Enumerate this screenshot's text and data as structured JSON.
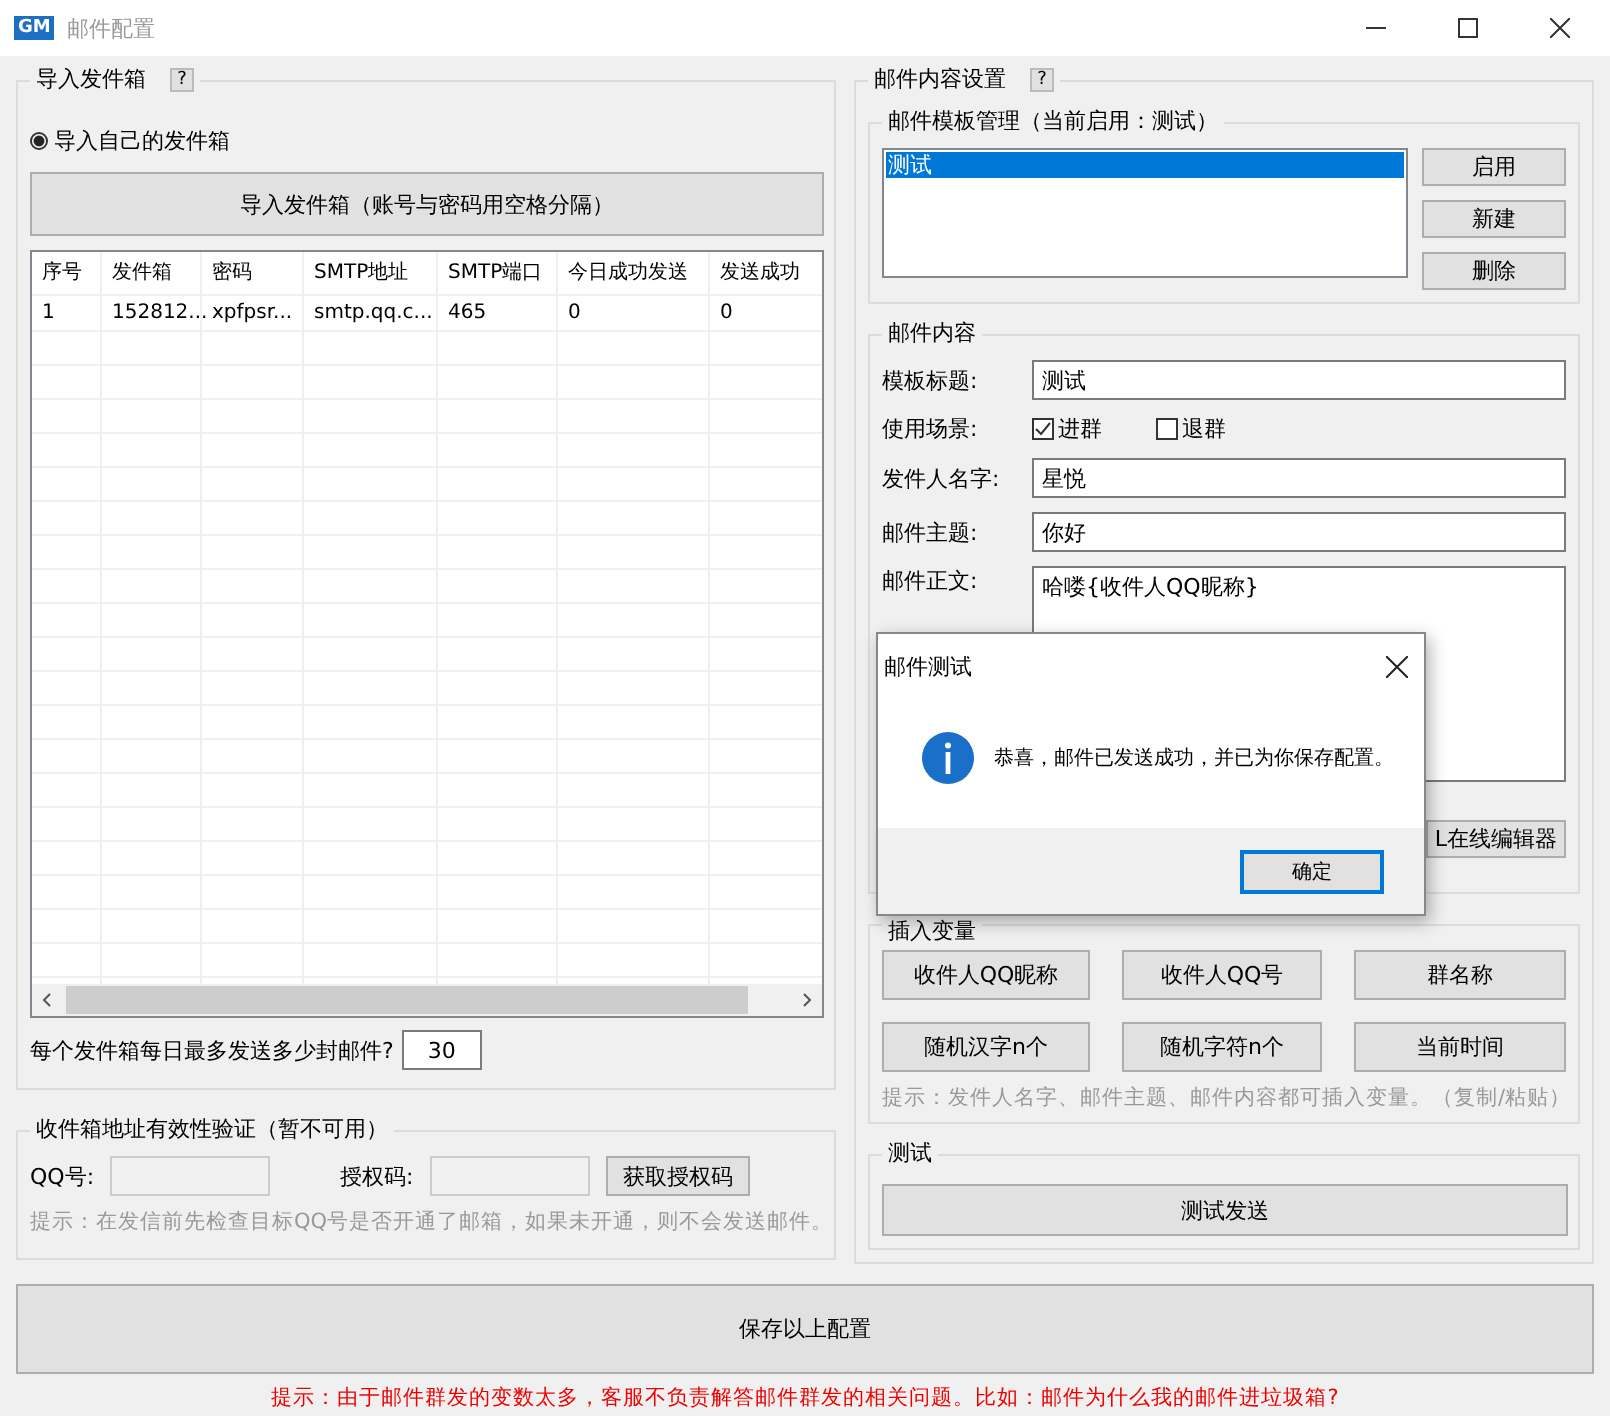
{
  "window": {
    "logo": "GM",
    "title": "邮件配置"
  },
  "import_group": {
    "title": "导入发件箱",
    "help": "?",
    "radio": {
      "label": "导入自己的发件箱",
      "selected": true
    },
    "import_button": "导入发件箱（账号与密码用空格分隔）",
    "table": {
      "columns": [
        "序号",
        "发件箱",
        "密码",
        "SMTP地址",
        "SMTP端口",
        "今日成功发送",
        "发送成功"
      ],
      "rows": [
        [
          "1",
          "152812...",
          "xpfpsr...",
          "smtp.qq.c...",
          "465",
          "0",
          "0"
        ]
      ]
    },
    "daily_limit": {
      "label": "每个发件箱每日最多发送多少封邮件?",
      "value": "30"
    }
  },
  "verify_group": {
    "title": "收件箱地址有效性验证（暂不可用）",
    "qq_label": "QQ号:",
    "auth_label": "授权码:",
    "get_button": "获取授权码",
    "hint": "提示：在发信前先检查目标QQ号是否开通了邮箱，如果未开通，则不会发送邮件。"
  },
  "content_group": {
    "title": "邮件内容设置",
    "help": "?",
    "template_group": {
      "title": "邮件模板管理（当前启用：测试）",
      "items": [
        {
          "label": "测试",
          "selected": true
        }
      ],
      "buttons": [
        "启用",
        "新建",
        "删除"
      ]
    },
    "mail_group": {
      "title": "邮件内容",
      "template_title": {
        "label": "模板标题:",
        "value": "测试"
      },
      "scene": {
        "label": "使用场景:",
        "options": [
          {
            "label": "进群",
            "checked": true
          },
          {
            "label": "退群",
            "checked": false
          }
        ]
      },
      "sender_name": {
        "label": "发件人名字:",
        "value": "星悦"
      },
      "subject": {
        "label": "邮件主题:",
        "value": "你好"
      },
      "body": {
        "label": "邮件正文:",
        "value": "哈喽{收件人QQ昵称}"
      },
      "editor_button": "L在线编辑器"
    },
    "variables_group": {
      "title": "插入变量",
      "buttons": [
        "收件人QQ昵称",
        "收件人QQ号",
        "群名称",
        "随机汉字n个",
        "随机字符n个",
        "当前时间"
      ],
      "hint": "提示：发件人名字、邮件主题、邮件内容都可插入变量。（复制/粘贴）"
    },
    "test_group": {
      "title": "测试",
      "button": "测试发送"
    }
  },
  "save_button": "保存以上配置",
  "footer_hint": "提示：由于邮件群发的变数太多，客服不负责解答邮件群发的相关问题。比如：邮件为什么我的邮件进垃圾箱?",
  "dialog": {
    "title": "邮件测试",
    "message": "恭喜，邮件已发送成功，并已为你保存配置。",
    "button": "确定"
  }
}
